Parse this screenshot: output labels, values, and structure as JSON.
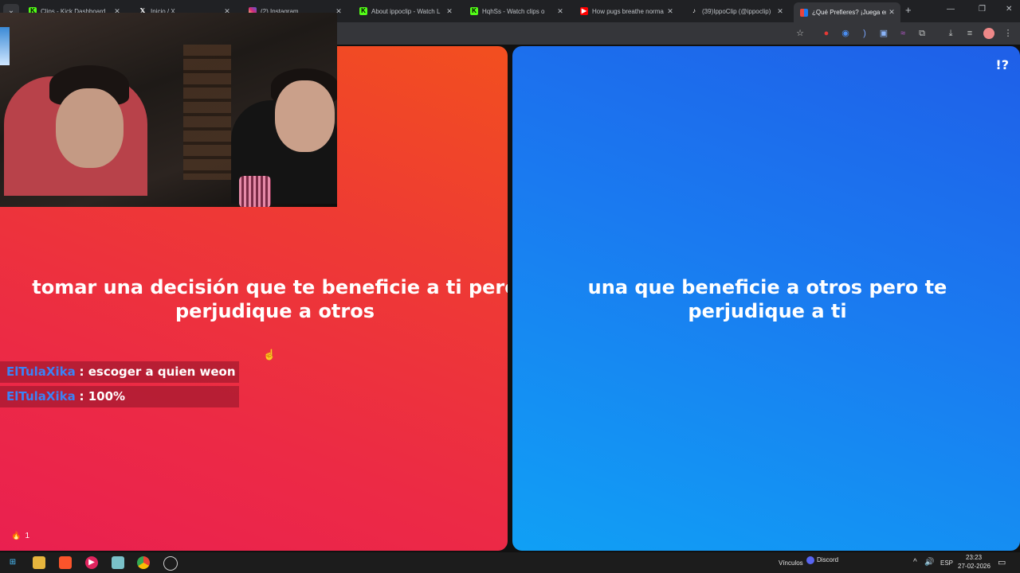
{
  "tabs": [
    {
      "title": "Clips - Kick Dashboard",
      "icon": "kick-icon",
      "icon_color": "#53fc18"
    },
    {
      "title": "Inicio / X",
      "icon": "x-icon",
      "icon_color": "#000000"
    },
    {
      "title": "(2) Instagram",
      "icon": "instagram-icon",
      "icon_color": "#d6249f"
    },
    {
      "title": "About ippoclip - Watch L",
      "icon": "kick-icon",
      "icon_color": "#53fc18"
    },
    {
      "title": "HqhSs - Watch clips o",
      "icon": "kick-icon",
      "icon_color": "#53fc18"
    },
    {
      "title": "How pugs breathe norma",
      "icon": "youtube-icon",
      "icon_color": "#ff0000"
    },
    {
      "title": "(39)IppoClip (@ippoclip)",
      "icon": "tiktok-icon",
      "icon_color": "#000000"
    },
    {
      "title": "¿Qué Prefieres? ¡Juega en",
      "icon": "quiz-icon",
      "icon_color": "#e8453c"
    }
  ],
  "game": {
    "logo": "!?",
    "option_a": "tomar una decisión que te beneficie a ti pero perjudique a otros",
    "option_b": "una que beneficie a otros pero te perjudique a ti",
    "likes": "1"
  },
  "chat": [
    {
      "user": "ElTulaXika",
      "message": ": escoger a quien weon"
    },
    {
      "user": "ElTulaXika",
      "message": ": 100%"
    }
  ],
  "taskbar": {
    "links_label": "Vínculos",
    "discord_label": "Discord",
    "language": "ESP",
    "time": "23:23",
    "date": "27-02-2026"
  },
  "colors": {
    "red_panel": "#ec2a45",
    "blue_panel": "#1a7af0",
    "chat_username": "#3b82f6"
  }
}
